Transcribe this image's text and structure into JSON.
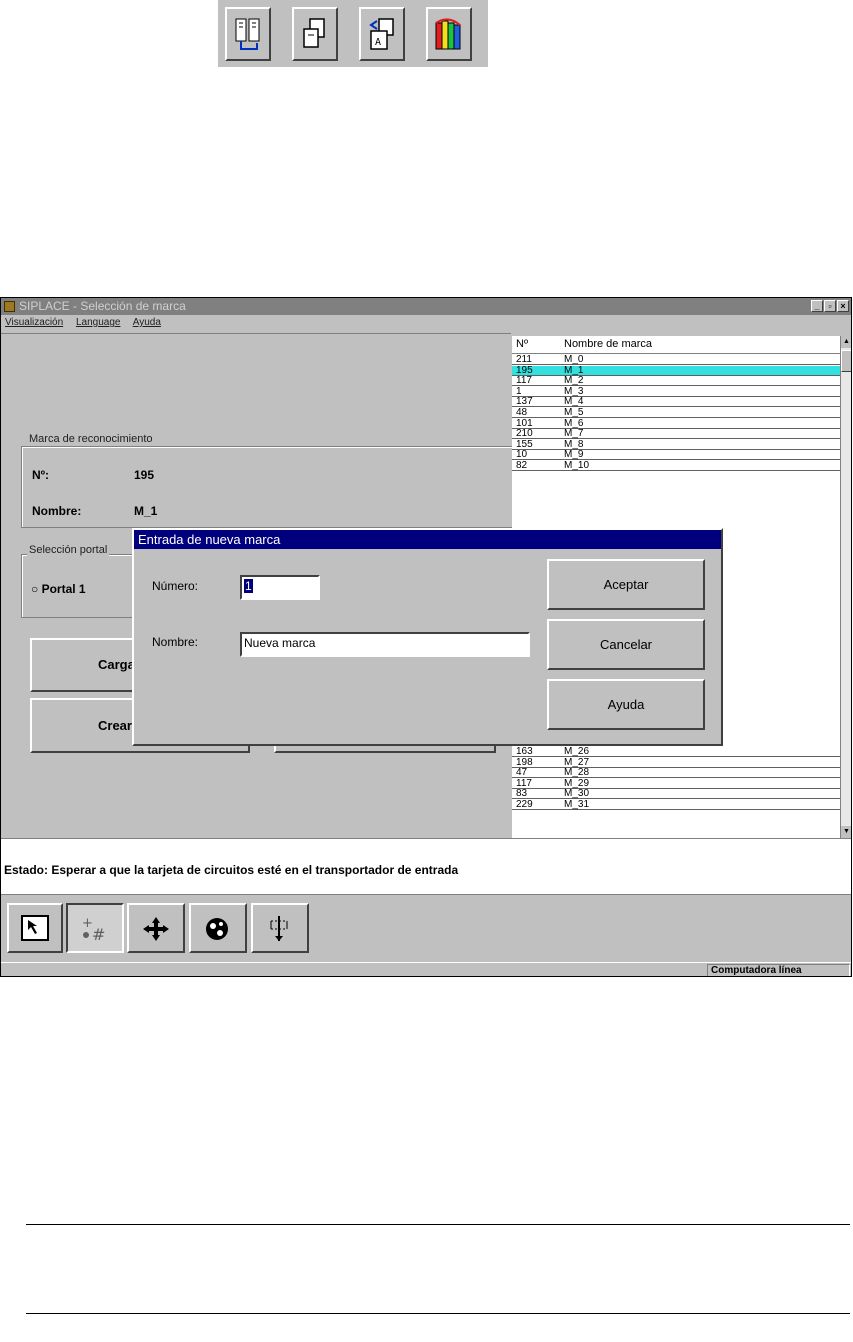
{
  "window": {
    "title": "SIPLACE - Selección de marca",
    "menu": [
      "Visualización",
      "Language",
      "Ayuda"
    ]
  },
  "mark_group": {
    "title": "Marca de reconocimiento",
    "num_label": "Nº:",
    "num_value": "195",
    "name_label": "Nombre:",
    "name_value": "M_1"
  },
  "portal_group": {
    "title": "Selección portal",
    "option1": "Portal 1"
  },
  "buttons": {
    "load": "Carga",
    "create": "Crear"
  },
  "list": {
    "col_num": "Nº",
    "col_name": "Nombre de marca",
    "rows_top": [
      {
        "num": "211",
        "name": "M_0"
      },
      {
        "num": "195",
        "name": "M_1"
      },
      {
        "num": "117",
        "name": "M_2"
      },
      {
        "num": "1",
        "name": "M_3"
      },
      {
        "num": "137",
        "name": "M_4"
      },
      {
        "num": "48",
        "name": "M_5"
      },
      {
        "num": "101",
        "name": "M_6"
      },
      {
        "num": "210",
        "name": "M_7"
      },
      {
        "num": "155",
        "name": "M_8"
      },
      {
        "num": "10",
        "name": "M_9"
      },
      {
        "num": "82",
        "name": "M_10"
      }
    ],
    "rows_bottom": [
      {
        "num": "163",
        "name": "M_26"
      },
      {
        "num": "198",
        "name": "M_27"
      },
      {
        "num": "47",
        "name": "M_28"
      },
      {
        "num": "117",
        "name": "M_29"
      },
      {
        "num": "83",
        "name": "M_30"
      },
      {
        "num": "229",
        "name": "M_31"
      }
    ]
  },
  "dialog": {
    "title": "Entrada de nueva marca",
    "number_label": "Número:",
    "number_value": "1",
    "name_label": "Nombre:",
    "name_value": "Nueva marca",
    "accept": "Aceptar",
    "cancel": "Cancelar",
    "help": "Ayuda"
  },
  "status": {
    "text": "Estado: Esperar a que la tarjeta de circuitos esté en el transportador de entrada"
  },
  "statusbar": {
    "panel": "Computadora línea"
  }
}
